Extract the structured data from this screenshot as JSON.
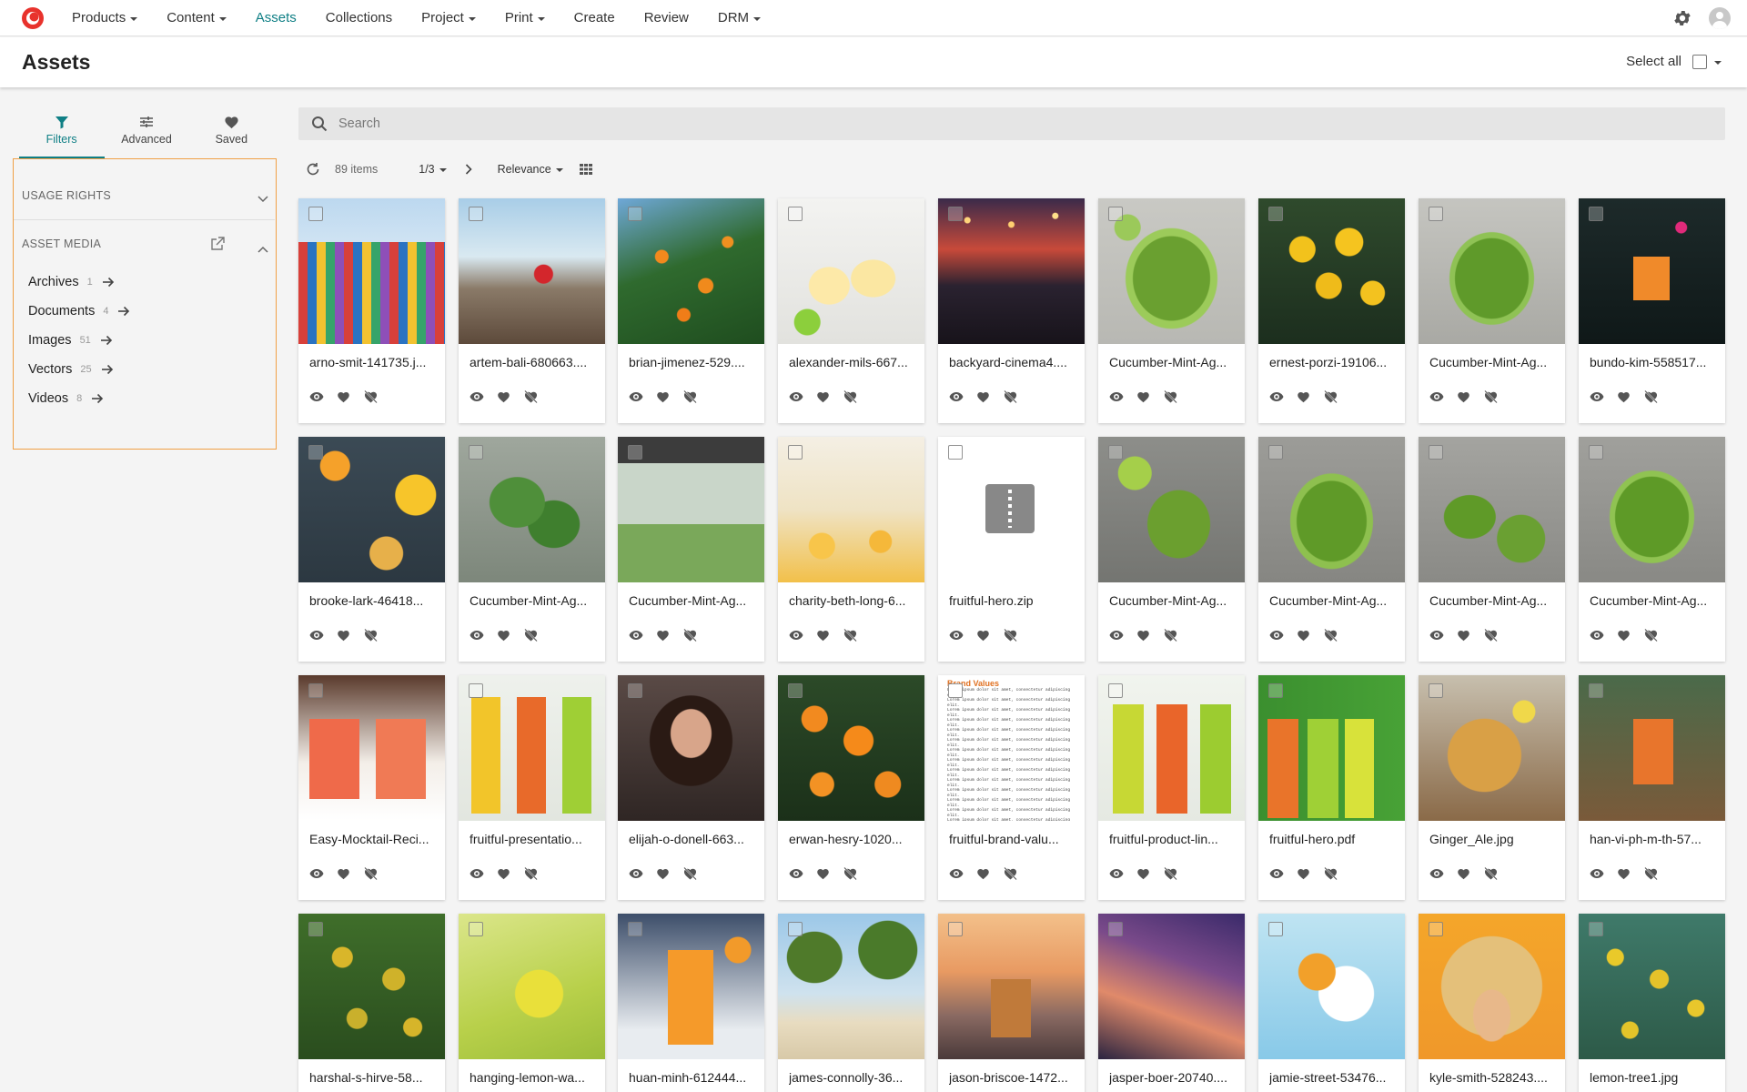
{
  "nav": {
    "items": [
      {
        "label": "Products",
        "dropdown": true
      },
      {
        "label": "Content",
        "dropdown": true
      },
      {
        "label": "Assets",
        "dropdown": false,
        "active": true
      },
      {
        "label": "Collections",
        "dropdown": false
      },
      {
        "label": "Project",
        "dropdown": true
      },
      {
        "label": "Print",
        "dropdown": true
      },
      {
        "label": "Create",
        "dropdown": false
      },
      {
        "label": "Review",
        "dropdown": false
      },
      {
        "label": "DRM",
        "dropdown": true
      }
    ],
    "accent": "#0f7f85",
    "logo_color": "#e8322c",
    "icons": [
      "logo-icon",
      "gear-icon",
      "user-avatar-icon"
    ]
  },
  "header": {
    "title": "Assets",
    "select_all_label": "Select all"
  },
  "sidebar": {
    "tabs": [
      {
        "label": "Filters",
        "icon": "filter-icon",
        "active": true
      },
      {
        "label": "Advanced",
        "icon": "sliders-icon"
      },
      {
        "label": "Saved",
        "icon": "heart-icon"
      }
    ],
    "sections": [
      {
        "label": "USAGE RIGHTS",
        "expanded": false
      },
      {
        "label": "ASSET MEDIA",
        "expanded": true
      }
    ],
    "media_items": [
      {
        "label": "Archives",
        "count": "1"
      },
      {
        "label": "Documents",
        "count": "4"
      },
      {
        "label": "Images",
        "count": "51"
      },
      {
        "label": "Vectors",
        "count": "25"
      },
      {
        "label": "Videos",
        "count": "8"
      }
    ],
    "highlight_color": "#f0a045"
  },
  "search": {
    "placeholder": "Search",
    "value": ""
  },
  "toolbar": {
    "items_count": "89 items",
    "page": "1/3",
    "sort": "Relevance"
  },
  "assets": [
    {
      "name": "arno-smit-141735.j...",
      "thumb": "beach-huts"
    },
    {
      "name": "artem-bali-680663....",
      "thumb": "beach-rock"
    },
    {
      "name": "brian-jimenez-529....",
      "thumb": "orange-tree"
    },
    {
      "name": "alexander-mils-667...",
      "thumb": "lemonade"
    },
    {
      "name": "backyard-cinema4....",
      "thumb": "night-cinema"
    },
    {
      "name": "Cucumber-Mint-Ag...",
      "thumb": "green-jar"
    },
    {
      "name": "ernest-porzi-19106...",
      "thumb": "lemons"
    },
    {
      "name": "Cucumber-Mint-Ag...",
      "thumb": "green-glass"
    },
    {
      "name": "bundo-kim-558517...",
      "thumb": "orange-cocktail"
    },
    {
      "name": "brooke-lark-46418...",
      "thumb": "citrus-flatlay"
    },
    {
      "name": "Cucumber-Mint-Ag...",
      "thumb": "green-leaves"
    },
    {
      "name": "Cucumber-Mint-Ag...",
      "thumb": "blender"
    },
    {
      "name": "charity-beth-long-6...",
      "thumb": "lemon-glasses"
    },
    {
      "name": "fruitful-hero.zip",
      "thumb": "zip"
    },
    {
      "name": "Cucumber-Mint-Ag...",
      "thumb": "limes-mint"
    },
    {
      "name": "Cucumber-Mint-Ag...",
      "thumb": "green-drink"
    },
    {
      "name": "Cucumber-Mint-Ag...",
      "thumb": "green-drinks"
    },
    {
      "name": "Cucumber-Mint-Ag...",
      "thumb": "green-drink-2"
    },
    {
      "name": "Easy-Mocktail-Reci...",
      "thumb": "mocktail"
    },
    {
      "name": "fruitful-presentatio...",
      "thumb": "bottles"
    },
    {
      "name": "elijah-o-donell-663...",
      "thumb": "woman-phone"
    },
    {
      "name": "erwan-hesry-1020...",
      "thumb": "oranges"
    },
    {
      "name": "fruitful-brand-valu...",
      "thumb": "document"
    },
    {
      "name": "fruitful-product-lin...",
      "thumb": "bottles-2"
    },
    {
      "name": "fruitful-hero.pdf",
      "thumb": "bottles-green"
    },
    {
      "name": "Ginger_Ale.jpg",
      "thumb": "ginger-ale"
    },
    {
      "name": "han-vi-ph-m-th-57...",
      "thumb": "orange-drink"
    },
    {
      "name": "harshal-s-hirve-58...",
      "thumb": "lime-tree"
    },
    {
      "name": "hanging-lemon-wa...",
      "thumb": "hanging-lemon"
    },
    {
      "name": "huan-minh-612444...",
      "thumb": "orange-juice"
    },
    {
      "name": "james-connolly-36...",
      "thumb": "palms"
    },
    {
      "name": "jason-briscoe-1472...",
      "thumb": "sunset-drink"
    },
    {
      "name": "jasper-boer-20740....",
      "thumb": "palm-sunset"
    },
    {
      "name": "jamie-street-53476...",
      "thumb": "splash"
    },
    {
      "name": "kyle-smith-528243....",
      "thumb": "girl-hair"
    },
    {
      "name": "lemon-tree1.jpg",
      "thumb": "lemon-tree"
    }
  ],
  "document_preview": {
    "heading": "Brand Values",
    "line": "Lorem ipsum dolor sit amet, consectetur adipiscing elit."
  }
}
